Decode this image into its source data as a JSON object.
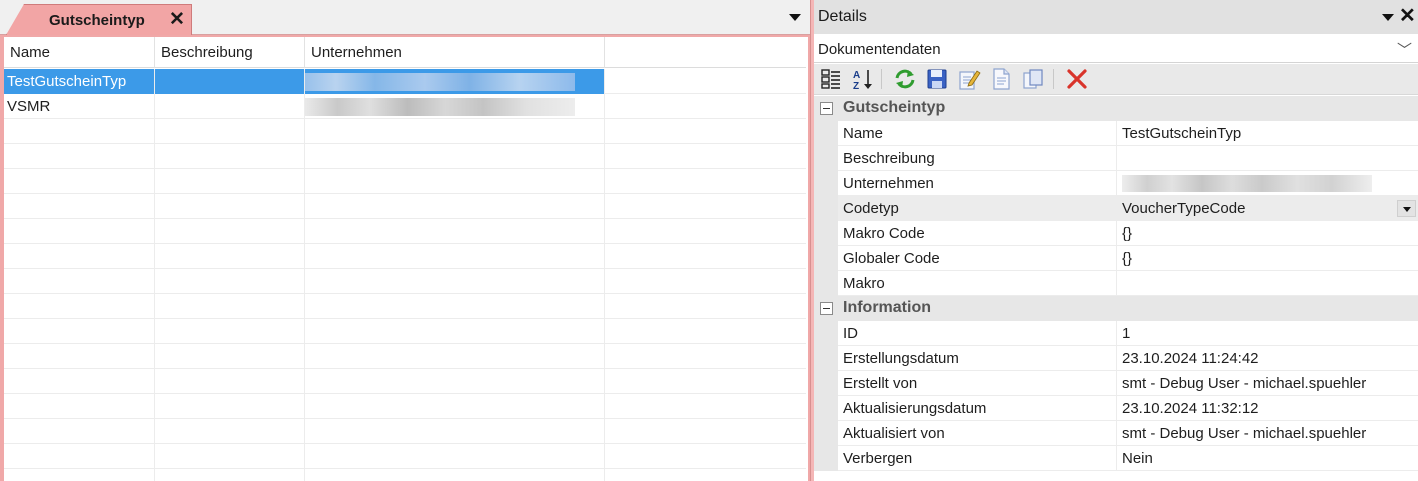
{
  "left_pane": {
    "tab": {
      "label": "Gutscheintyp",
      "close": "✕"
    },
    "grid": {
      "columns": [
        "Name",
        "Beschreibung",
        "Unternehmen"
      ],
      "rows": [
        {
          "name": "TestGutscheinTyp",
          "description": "",
          "company": ""
        },
        {
          "name": "VSMR",
          "description": "",
          "company": ""
        }
      ]
    }
  },
  "details": {
    "title": "Details",
    "close": "✕",
    "dropdown": {
      "value": "Dokumentendaten",
      "chevron": "﹀"
    },
    "toolbar": [
      "categorized-view-icon",
      "sort-alphabetical-icon",
      "refresh-icon",
      "save-icon",
      "edit-icon",
      "new-document-icon",
      "copy-icon",
      "delete-icon"
    ],
    "categories": [
      {
        "label": "Gutscheintyp",
        "properties": [
          {
            "name": "Name",
            "value": "TestGutscheinTyp"
          },
          {
            "name": "Beschreibung",
            "value": ""
          },
          {
            "name": "Unternehmen",
            "value": ""
          },
          {
            "name": "Codetyp",
            "value": "VoucherTypeCode"
          },
          {
            "name": "Makro Code",
            "value": "{}"
          },
          {
            "name": "Globaler Code",
            "value": "{}"
          },
          {
            "name": "Makro",
            "value": ""
          }
        ]
      },
      {
        "label": "Information",
        "properties": [
          {
            "name": "ID",
            "value": "1"
          },
          {
            "name": "Erstellungsdatum",
            "value": "23.10.2024 11:24:42"
          },
          {
            "name": "Erstellt von",
            "value": "smt - Debug User - michael.spuehler"
          },
          {
            "name": "Aktualisierungsdatum",
            "value": "23.10.2024 11:32:12"
          },
          {
            "name": "Aktualisiert von",
            "value": "smt - Debug User - michael.spuehler"
          },
          {
            "name": "Verbergen",
            "value": "Nein"
          }
        ]
      }
    ]
  },
  "colors": {
    "tab_accent": "#f2a5a5",
    "selection": "#3c9ae8",
    "delete_red": "#d9342b"
  }
}
